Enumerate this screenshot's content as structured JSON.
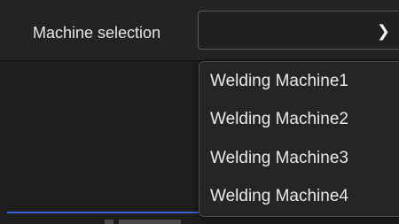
{
  "machine_selection": {
    "label": "Machine selection",
    "selected_value": "",
    "chevron_icon": "chevron-down-icon",
    "options": [
      "Welding Machine1",
      "Welding Machine2",
      "Welding Machine3",
      "Welding Machine4"
    ]
  },
  "colors": {
    "background": "#1f1f1f",
    "text": "#e6e6e6",
    "accent": "#3b5bdb"
  }
}
